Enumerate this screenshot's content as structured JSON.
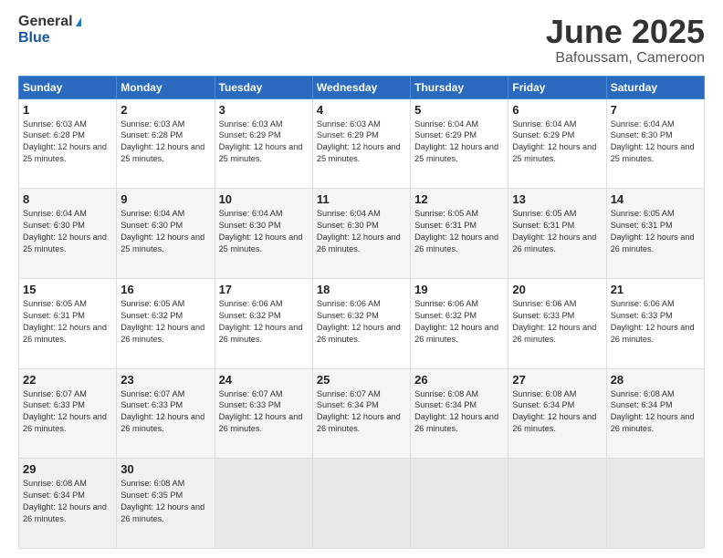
{
  "header": {
    "logo_line1": "General",
    "logo_line2": "Blue",
    "month_title": "June 2025",
    "subtitle": "Bafoussam, Cameroon"
  },
  "calendar": {
    "days_of_week": [
      "Sunday",
      "Monday",
      "Tuesday",
      "Wednesday",
      "Thursday",
      "Friday",
      "Saturday"
    ],
    "weeks": [
      [
        {
          "day": "1",
          "sunrise": "Sunrise: 6:03 AM",
          "sunset": "Sunset: 6:28 PM",
          "daylight": "Daylight: 12 hours and 25 minutes."
        },
        {
          "day": "2",
          "sunrise": "Sunrise: 6:03 AM",
          "sunset": "Sunset: 6:28 PM",
          "daylight": "Daylight: 12 hours and 25 minutes."
        },
        {
          "day": "3",
          "sunrise": "Sunrise: 6:03 AM",
          "sunset": "Sunset: 6:29 PM",
          "daylight": "Daylight: 12 hours and 25 minutes."
        },
        {
          "day": "4",
          "sunrise": "Sunrise: 6:03 AM",
          "sunset": "Sunset: 6:29 PM",
          "daylight": "Daylight: 12 hours and 25 minutes."
        },
        {
          "day": "5",
          "sunrise": "Sunrise: 6:04 AM",
          "sunset": "Sunset: 6:29 PM",
          "daylight": "Daylight: 12 hours and 25 minutes."
        },
        {
          "day": "6",
          "sunrise": "Sunrise: 6:04 AM",
          "sunset": "Sunset: 6:29 PM",
          "daylight": "Daylight: 12 hours and 25 minutes."
        },
        {
          "day": "7",
          "sunrise": "Sunrise: 6:04 AM",
          "sunset": "Sunset: 6:30 PM",
          "daylight": "Daylight: 12 hours and 25 minutes."
        }
      ],
      [
        {
          "day": "8",
          "sunrise": "Sunrise: 6:04 AM",
          "sunset": "Sunset: 6:30 PM",
          "daylight": "Daylight: 12 hours and 25 minutes."
        },
        {
          "day": "9",
          "sunrise": "Sunrise: 6:04 AM",
          "sunset": "Sunset: 6:30 PM",
          "daylight": "Daylight: 12 hours and 25 minutes."
        },
        {
          "day": "10",
          "sunrise": "Sunrise: 6:04 AM",
          "sunset": "Sunset: 6:30 PM",
          "daylight": "Daylight: 12 hours and 25 minutes."
        },
        {
          "day": "11",
          "sunrise": "Sunrise: 6:04 AM",
          "sunset": "Sunset: 6:30 PM",
          "daylight": "Daylight: 12 hours and 26 minutes."
        },
        {
          "day": "12",
          "sunrise": "Sunrise: 6:05 AM",
          "sunset": "Sunset: 6:31 PM",
          "daylight": "Daylight: 12 hours and 26 minutes."
        },
        {
          "day": "13",
          "sunrise": "Sunrise: 6:05 AM",
          "sunset": "Sunset: 6:31 PM",
          "daylight": "Daylight: 12 hours and 26 minutes."
        },
        {
          "day": "14",
          "sunrise": "Sunrise: 6:05 AM",
          "sunset": "Sunset: 6:31 PM",
          "daylight": "Daylight: 12 hours and 26 minutes."
        }
      ],
      [
        {
          "day": "15",
          "sunrise": "Sunrise: 6:05 AM",
          "sunset": "Sunset: 6:31 PM",
          "daylight": "Daylight: 12 hours and 26 minutes."
        },
        {
          "day": "16",
          "sunrise": "Sunrise: 6:05 AM",
          "sunset": "Sunset: 6:32 PM",
          "daylight": "Daylight: 12 hours and 26 minutes."
        },
        {
          "day": "17",
          "sunrise": "Sunrise: 6:06 AM",
          "sunset": "Sunset: 6:32 PM",
          "daylight": "Daylight: 12 hours and 26 minutes."
        },
        {
          "day": "18",
          "sunrise": "Sunrise: 6:06 AM",
          "sunset": "Sunset: 6:32 PM",
          "daylight": "Daylight: 12 hours and 26 minutes."
        },
        {
          "day": "19",
          "sunrise": "Sunrise: 6:06 AM",
          "sunset": "Sunset: 6:32 PM",
          "daylight": "Daylight: 12 hours and 26 minutes."
        },
        {
          "day": "20",
          "sunrise": "Sunrise: 6:06 AM",
          "sunset": "Sunset: 6:33 PM",
          "daylight": "Daylight: 12 hours and 26 minutes."
        },
        {
          "day": "21",
          "sunrise": "Sunrise: 6:06 AM",
          "sunset": "Sunset: 6:33 PM",
          "daylight": "Daylight: 12 hours and 26 minutes."
        }
      ],
      [
        {
          "day": "22",
          "sunrise": "Sunrise: 6:07 AM",
          "sunset": "Sunset: 6:33 PM",
          "daylight": "Daylight: 12 hours and 26 minutes."
        },
        {
          "day": "23",
          "sunrise": "Sunrise: 6:07 AM",
          "sunset": "Sunset: 6:33 PM",
          "daylight": "Daylight: 12 hours and 26 minutes."
        },
        {
          "day": "24",
          "sunrise": "Sunrise: 6:07 AM",
          "sunset": "Sunset: 6:33 PM",
          "daylight": "Daylight: 12 hours and 26 minutes."
        },
        {
          "day": "25",
          "sunrise": "Sunrise: 6:07 AM",
          "sunset": "Sunset: 6:34 PM",
          "daylight": "Daylight: 12 hours and 26 minutes."
        },
        {
          "day": "26",
          "sunrise": "Sunrise: 6:08 AM",
          "sunset": "Sunset: 6:34 PM",
          "daylight": "Daylight: 12 hours and 26 minutes."
        },
        {
          "day": "27",
          "sunrise": "Sunrise: 6:08 AM",
          "sunset": "Sunset: 6:34 PM",
          "daylight": "Daylight: 12 hours and 26 minutes."
        },
        {
          "day": "28",
          "sunrise": "Sunrise: 6:08 AM",
          "sunset": "Sunset: 6:34 PM",
          "daylight": "Daylight: 12 hours and 26 minutes."
        }
      ],
      [
        {
          "day": "29",
          "sunrise": "Sunrise: 6:08 AM",
          "sunset": "Sunset: 6:34 PM",
          "daylight": "Daylight: 12 hours and 26 minutes."
        },
        {
          "day": "30",
          "sunrise": "Sunrise: 6:08 AM",
          "sunset": "Sunset: 6:35 PM",
          "daylight": "Daylight: 12 hours and 26 minutes."
        },
        null,
        null,
        null,
        null,
        null
      ]
    ]
  }
}
